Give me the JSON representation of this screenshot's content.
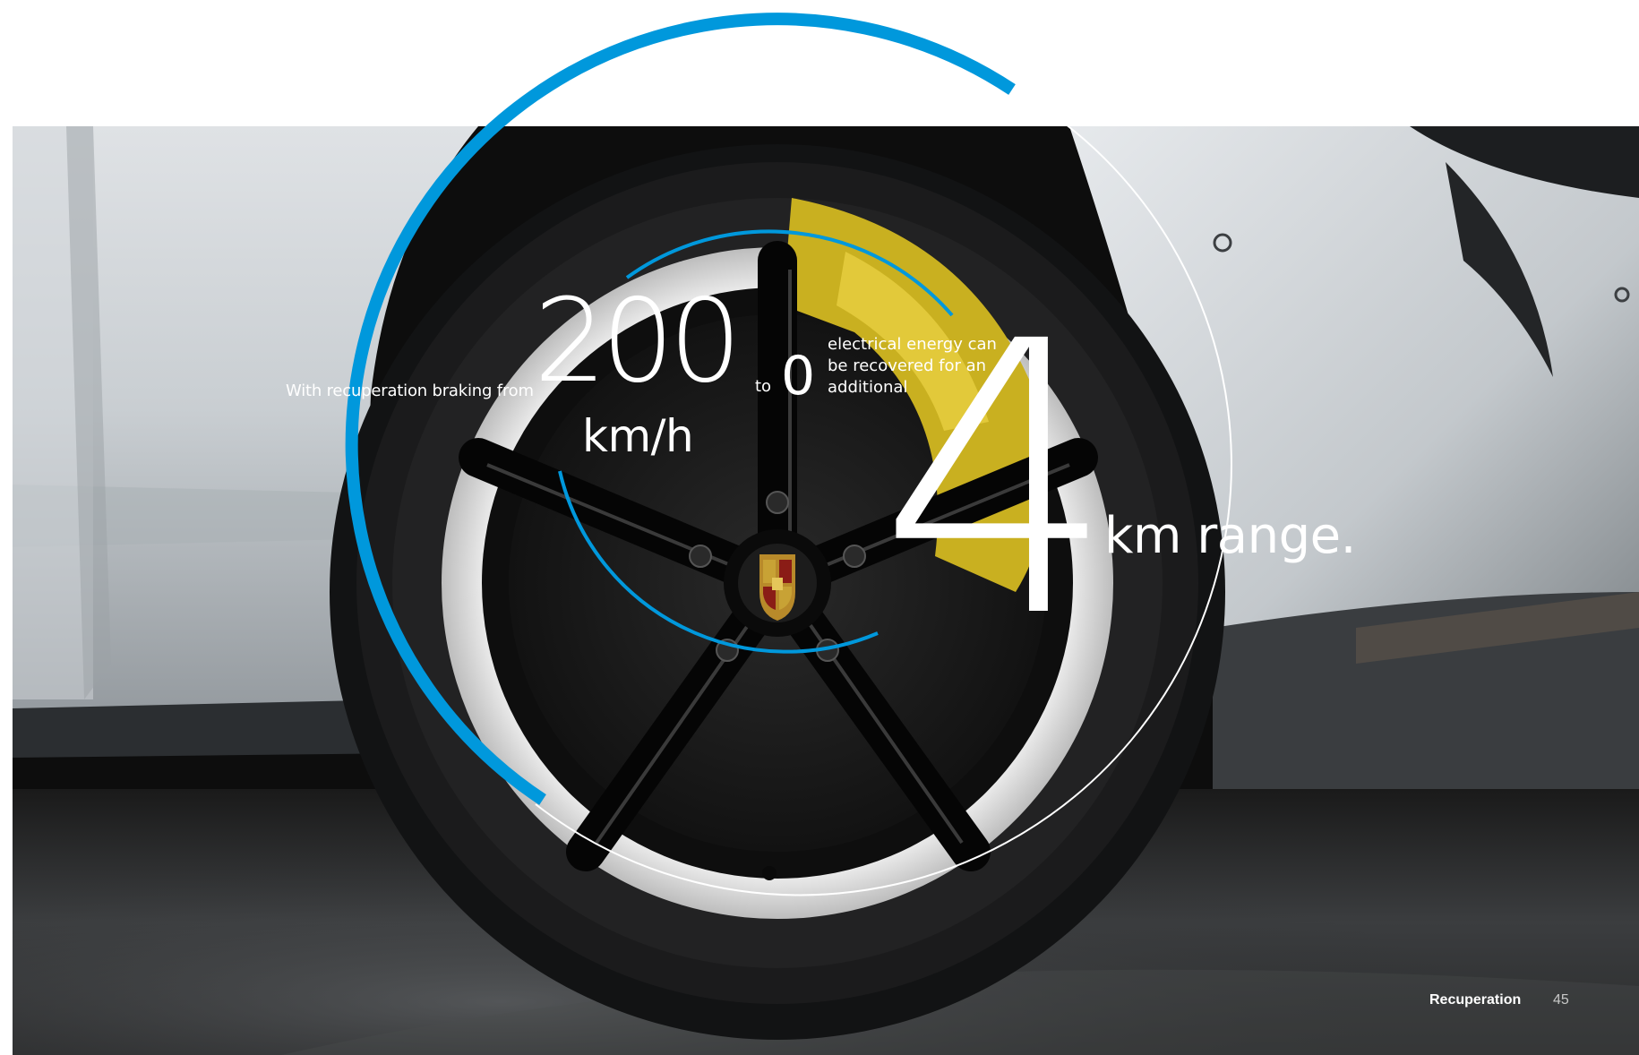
{
  "infographic": {
    "intro_text": "With recuperation braking from",
    "speed_value": "200",
    "speed_unit": "km/h",
    "to_label": "to",
    "end_speed": "0",
    "description": "electrical energy can be recovered for an additional",
    "range_value": "4",
    "range_suffix": "km range."
  },
  "footer": {
    "section_title": "Recuperation",
    "page_number": "45"
  },
  "colors": {
    "accent_blue": "#0098dc",
    "text": "#ffffff",
    "background": "#ffffff",
    "caliper": "#c9b020"
  },
  "icons": {
    "wheel": "car-wheel-photo",
    "emblem": "porsche-crest-icon"
  }
}
